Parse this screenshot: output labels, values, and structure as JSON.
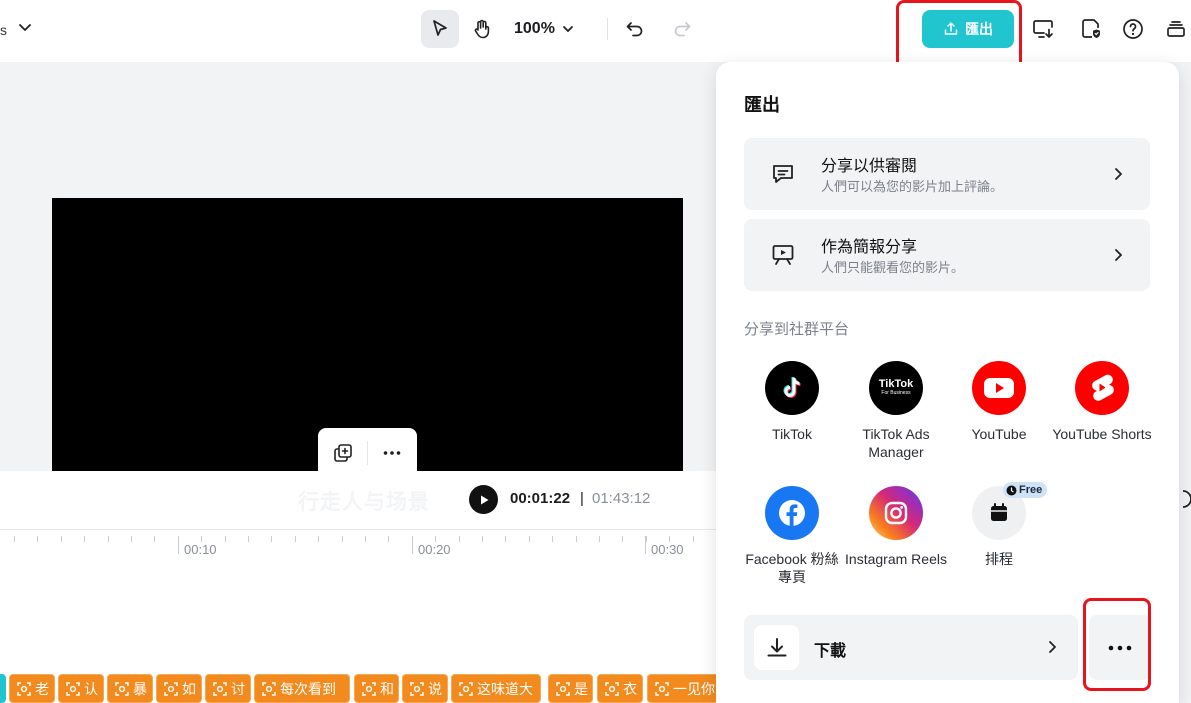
{
  "toolbar": {
    "left_dots": "s",
    "zoom_label": "100%",
    "export_label": "匯出"
  },
  "player": {
    "caption_ghost": "行走人与场景",
    "current_time": "00:01:22",
    "separator": "|",
    "total_time": "01:43:12"
  },
  "timeline": {
    "ticks": [
      "00:10",
      "00:20",
      "00:30"
    ],
    "clips": [
      {
        "text": "老"
      },
      {
        "text": "认"
      },
      {
        "text": "暴"
      },
      {
        "text": "如"
      },
      {
        "text": "讨"
      },
      {
        "text": "每次看到"
      },
      {
        "text": "和"
      },
      {
        "text": "说"
      },
      {
        "text": "这味道大"
      },
      {
        "text": "是"
      },
      {
        "text": "衣"
      },
      {
        "text": "一见你"
      }
    ]
  },
  "export_panel": {
    "title": "匯出",
    "options": [
      {
        "title": "分享以供審閱",
        "subtitle": "人們可以為您的影片加上評論。",
        "icon": "comment-icon"
      },
      {
        "title": "作為簡報分享",
        "subtitle": "人們只能觀看您的影片。",
        "icon": "presentation-icon"
      }
    ],
    "social_label": "分享到社群平台",
    "social": [
      {
        "name": "tiktok",
        "label": "TikTok",
        "color": "#000000"
      },
      {
        "name": "tiktok-ads",
        "label": "TikTok Ads Manager",
        "color": "#000000",
        "logo_text": "TikTok",
        "logo_sub": "For Business"
      },
      {
        "name": "youtube",
        "label": "YouTube",
        "color": "#ff0000"
      },
      {
        "name": "youtube-shorts",
        "label": "YouTube Shorts",
        "color": "#ff0000"
      },
      {
        "name": "facebook",
        "label": "Facebook 粉絲專頁",
        "color": "#1877f2"
      },
      {
        "name": "instagram",
        "label": "Instagram Reels",
        "color": "#e1306c"
      },
      {
        "name": "schedule",
        "label": "排程",
        "color": "#eef0f2"
      }
    ],
    "free_badge": "Free",
    "download_label": "下載"
  },
  "colors": {
    "accent": "#20c5cf",
    "highlight": "#e8141d",
    "clip": "#f38a1d"
  }
}
